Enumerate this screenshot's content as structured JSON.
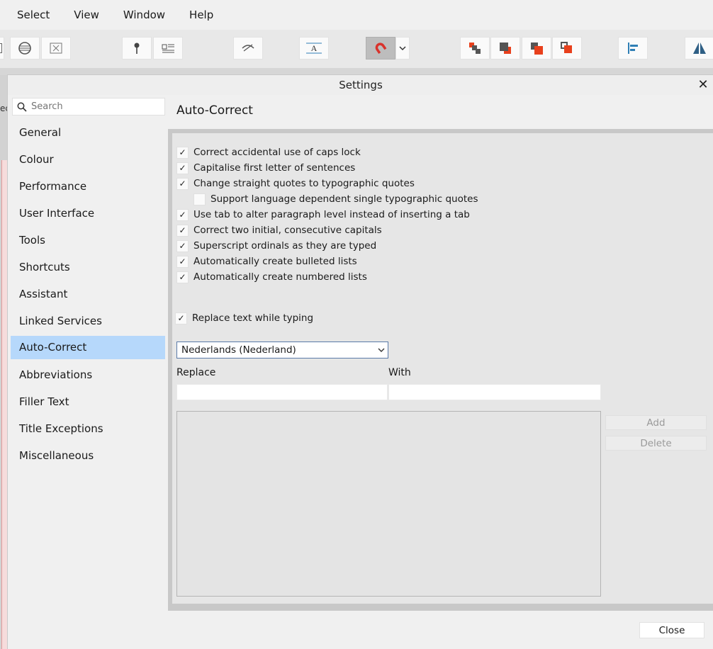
{
  "menu": {
    "items": [
      "Select",
      "View",
      "Window",
      "Help"
    ]
  },
  "toolbar": {
    "icons": [
      "wrap-shape-icon",
      "text-wrap-none-icon",
      "pin-icon",
      "text-frame-icon",
      "preview-icon",
      "baseline-grid-icon",
      "snapping-magnet-icon",
      "chevron-down-icon",
      "arrange-back-icon",
      "arrange-backward-icon",
      "arrange-forward-icon",
      "arrange-front-icon",
      "align-left-icon",
      "flip-horizontal-icon"
    ],
    "snapping_color": "#d9322b",
    "arrange_color": "#e8401c"
  },
  "background": {
    "left_fragment": "ec"
  },
  "dialog": {
    "title": "Settings",
    "close_glyph": "✕",
    "search_placeholder": "Search",
    "nav": {
      "items": [
        {
          "label": "General"
        },
        {
          "label": "Colour"
        },
        {
          "label": "Performance"
        },
        {
          "label": "User Interface"
        },
        {
          "label": "Tools"
        },
        {
          "label": "Shortcuts"
        },
        {
          "label": "Assistant"
        },
        {
          "label": "Linked Services"
        },
        {
          "label": "Auto-Correct",
          "selected": true
        },
        {
          "label": "Abbreviations"
        },
        {
          "label": "Filler Text"
        },
        {
          "label": "Title Exceptions"
        },
        {
          "label": "Miscellaneous"
        }
      ],
      "selected_color": "#b6d8fb"
    },
    "section_title": "Auto-Correct",
    "options": [
      {
        "label": "Correct accidental use of caps lock",
        "checked": true
      },
      {
        "label": "Capitalise first letter of sentences",
        "checked": true
      },
      {
        "label": "Change straight quotes to typographic quotes",
        "checked": true
      },
      {
        "label": "Support language dependent single typographic quotes",
        "checked": false
      },
      {
        "label": "Use tab to alter paragraph level instead of inserting a tab",
        "checked": true
      },
      {
        "label": "Correct two initial, consecutive capitals",
        "checked": true
      },
      {
        "label": "Superscript ordinals as they are typed",
        "checked": true
      },
      {
        "label": "Automatically create bulleted lists",
        "checked": true
      },
      {
        "label": "Automatically create numbered lists",
        "checked": true
      }
    ],
    "replace_while_typing": {
      "label": "Replace text while typing",
      "checked": true
    },
    "language": {
      "selected": "Nederlands (Nederland)"
    },
    "replace_label": "Replace",
    "with_label": "With",
    "replace_value": "",
    "with_value": "",
    "add_label": "Add",
    "delete_label": "Delete",
    "close_label": "Close",
    "check_glyph": "✓"
  }
}
